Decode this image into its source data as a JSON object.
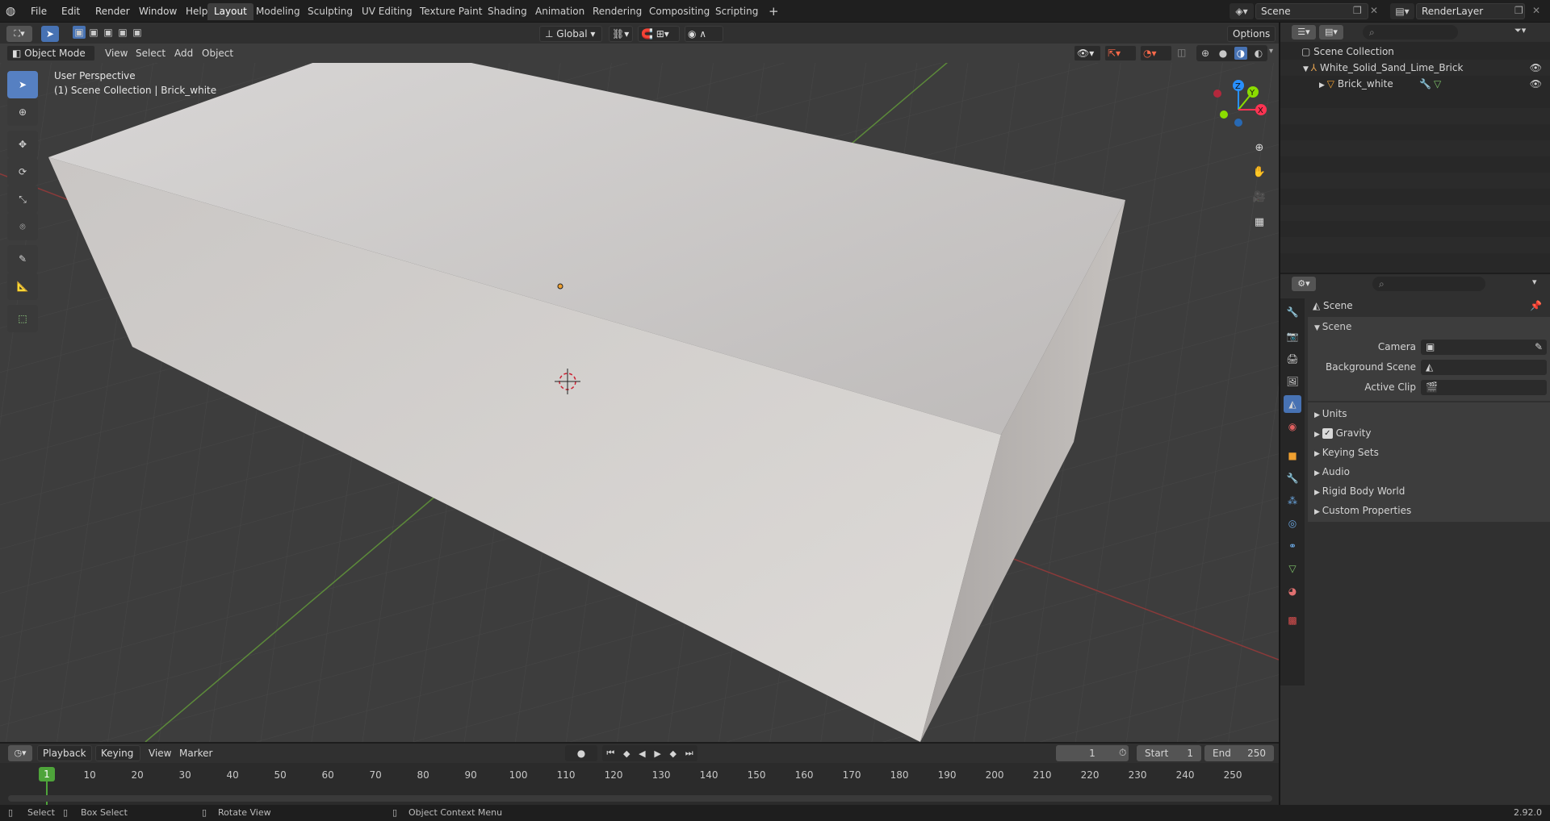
{
  "topbar": {
    "menus": [
      "File",
      "Edit",
      "Render",
      "Window",
      "Help"
    ],
    "workspaces": [
      "Layout",
      "Modeling",
      "Sculpting",
      "UV Editing",
      "Texture Paint",
      "Shading",
      "Animation",
      "Rendering",
      "Compositing",
      "Scripting"
    ],
    "active_workspace": "Layout",
    "add_tab_symbol": "+",
    "scene_name": "Scene",
    "view_layer_name": "RenderLayer"
  },
  "viewport_header": {
    "mode": "Object Mode",
    "menus": [
      "View",
      "Select",
      "Add",
      "Object"
    ],
    "transform_orientation": "Global",
    "options_label": "Options"
  },
  "viewport": {
    "perspective_label": "User Perspective",
    "collection_label": "(1) Scene Collection | Brick_white",
    "gizmo_axes": [
      "Z",
      "Y",
      "X"
    ]
  },
  "outliner": {
    "root": "Scene Collection",
    "collection": "White_Solid_Sand_Lime_Brick",
    "object": "Brick_white"
  },
  "properties": {
    "header_title": "Scene",
    "section_title": "Scene",
    "fields": [
      {
        "label": "Camera",
        "value": ""
      },
      {
        "label": "Background Scene",
        "value": ""
      },
      {
        "label": "Active Clip",
        "value": ""
      }
    ],
    "panels": [
      "Units",
      "Gravity",
      "Keying Sets",
      "Audio",
      "Rigid Body World",
      "Custom Properties"
    ],
    "gravity_checked": true
  },
  "timeline": {
    "menus": [
      "Playback",
      "Keying",
      "View",
      "Marker"
    ],
    "current_frame": "1",
    "start_label": "Start",
    "start_value": "1",
    "end_label": "End",
    "end_value": "250",
    "ticks": [
      "10",
      "20",
      "30",
      "40",
      "50",
      "60",
      "70",
      "80",
      "90",
      "100",
      "110",
      "120",
      "130",
      "140",
      "150",
      "160",
      "170",
      "180",
      "190",
      "200",
      "210",
      "220",
      "230",
      "240",
      "250"
    ],
    "playhead_label": "1"
  },
  "statusbar": {
    "select": "Select",
    "box_select": "Box Select",
    "rotate_view": "Rotate View",
    "context_menu": "Object Context Menu",
    "version": "2.92.0"
  },
  "colors": {
    "accent": "#4772b3",
    "active_tool": "#5680c2",
    "axis_x": "#ff3352",
    "axis_y": "#8bdc00",
    "axis_z": "#2890ff",
    "playhead": "#4ea43a"
  }
}
